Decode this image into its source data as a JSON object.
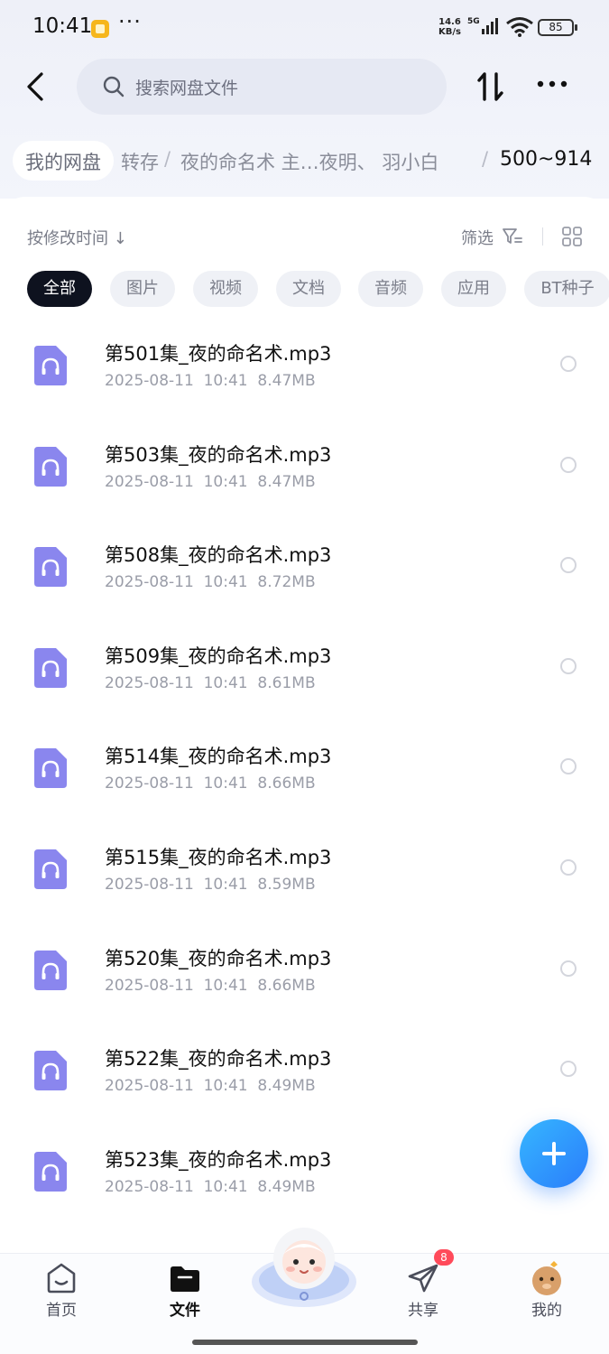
{
  "status_bar": {
    "time": "10:41",
    "network_speed_value": "14.6",
    "network_speed_unit": "KB/s",
    "signal_label": "5G",
    "battery": "85"
  },
  "search": {
    "placeholder": "搜索网盘文件"
  },
  "breadcrumb": {
    "root": "我的网盘",
    "items": [
      "转存",
      "夜的命名术 主…夜明、 羽小白"
    ],
    "separator": "/",
    "current": "500~914"
  },
  "toolbar": {
    "sort_label": "按修改时间 ↓",
    "filter_label": "筛选"
  },
  "filters": [
    "全部",
    "图片",
    "视频",
    "文档",
    "音频",
    "应用",
    "BT种子"
  ],
  "active_filter": "全部",
  "files": [
    {
      "name": "第501集_夜的命名术.mp3",
      "date": "2025-08-11",
      "time": "10:41",
      "size": "8.47MB"
    },
    {
      "name": "第503集_夜的命名术.mp3",
      "date": "2025-08-11",
      "time": "10:41",
      "size": "8.47MB"
    },
    {
      "name": "第508集_夜的命名术.mp3",
      "date": "2025-08-11",
      "time": "10:41",
      "size": "8.72MB"
    },
    {
      "name": "第509集_夜的命名术.mp3",
      "date": "2025-08-11",
      "time": "10:41",
      "size": "8.61MB"
    },
    {
      "name": "第514集_夜的命名术.mp3",
      "date": "2025-08-11",
      "time": "10:41",
      "size": "8.66MB"
    },
    {
      "name": "第515集_夜的命名术.mp3",
      "date": "2025-08-11",
      "time": "10:41",
      "size": "8.59MB"
    },
    {
      "name": "第520集_夜的命名术.mp3",
      "date": "2025-08-11",
      "time": "10:41",
      "size": "8.66MB"
    },
    {
      "name": "第522集_夜的命名术.mp3",
      "date": "2025-08-11",
      "time": "10:41",
      "size": "8.49MB"
    },
    {
      "name": "第523集_夜的命名术.mp3",
      "date": "2025-08-11",
      "time": "10:41",
      "size": "8.49MB"
    }
  ],
  "bottom_nav": {
    "items": [
      {
        "label": "首页",
        "icon": "home-icon"
      },
      {
        "label": "文件",
        "icon": "folder-icon"
      },
      {
        "label": "共享",
        "icon": "send-icon"
      },
      {
        "label": "我的",
        "icon": "profile-avatar-icon"
      }
    ],
    "share_badge": "8"
  },
  "colors": {
    "accent": "#2a7dfb",
    "audio_icon": "#8a86ee",
    "active_chip": "#0e121f",
    "badge": "#ff4a5a"
  }
}
